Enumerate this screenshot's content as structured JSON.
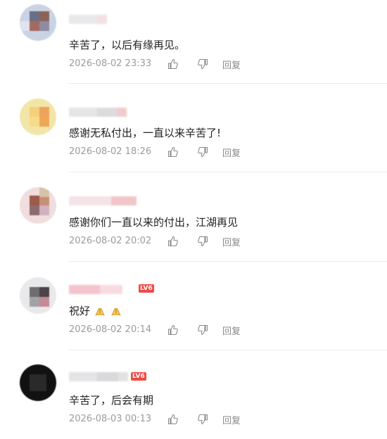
{
  "comments": [
    {
      "text": "辛苦了，以后有缘再见。",
      "time": "2026-08-02 23:33",
      "reply": "回复",
      "level": ""
    },
    {
      "text": "感谢无私付出，一直以来辛苦了!",
      "time": "2026-08-02 18:26",
      "reply": "回复",
      "level": ""
    },
    {
      "text": "感谢你们一直以来的付出，江湖再见",
      "time": "2026-08-02 20:02",
      "reply": "回复",
      "level": ""
    },
    {
      "text": "祝好",
      "time": "2026-08-02 20:14",
      "reply": "回复",
      "level": "LV6"
    },
    {
      "text": "辛苦了，后会有期",
      "time": "2026-08-03 00:13",
      "reply": "回复",
      "level": "LV6"
    }
  ],
  "icons": {
    "like": "thumbs-up-icon",
    "dislike": "thumbs-down-icon",
    "emoji": "folded-hands-emoji"
  },
  "colors": {
    "meta": "#9b9b9b",
    "level_badge": "#f04a45",
    "divider": "#ececec"
  }
}
